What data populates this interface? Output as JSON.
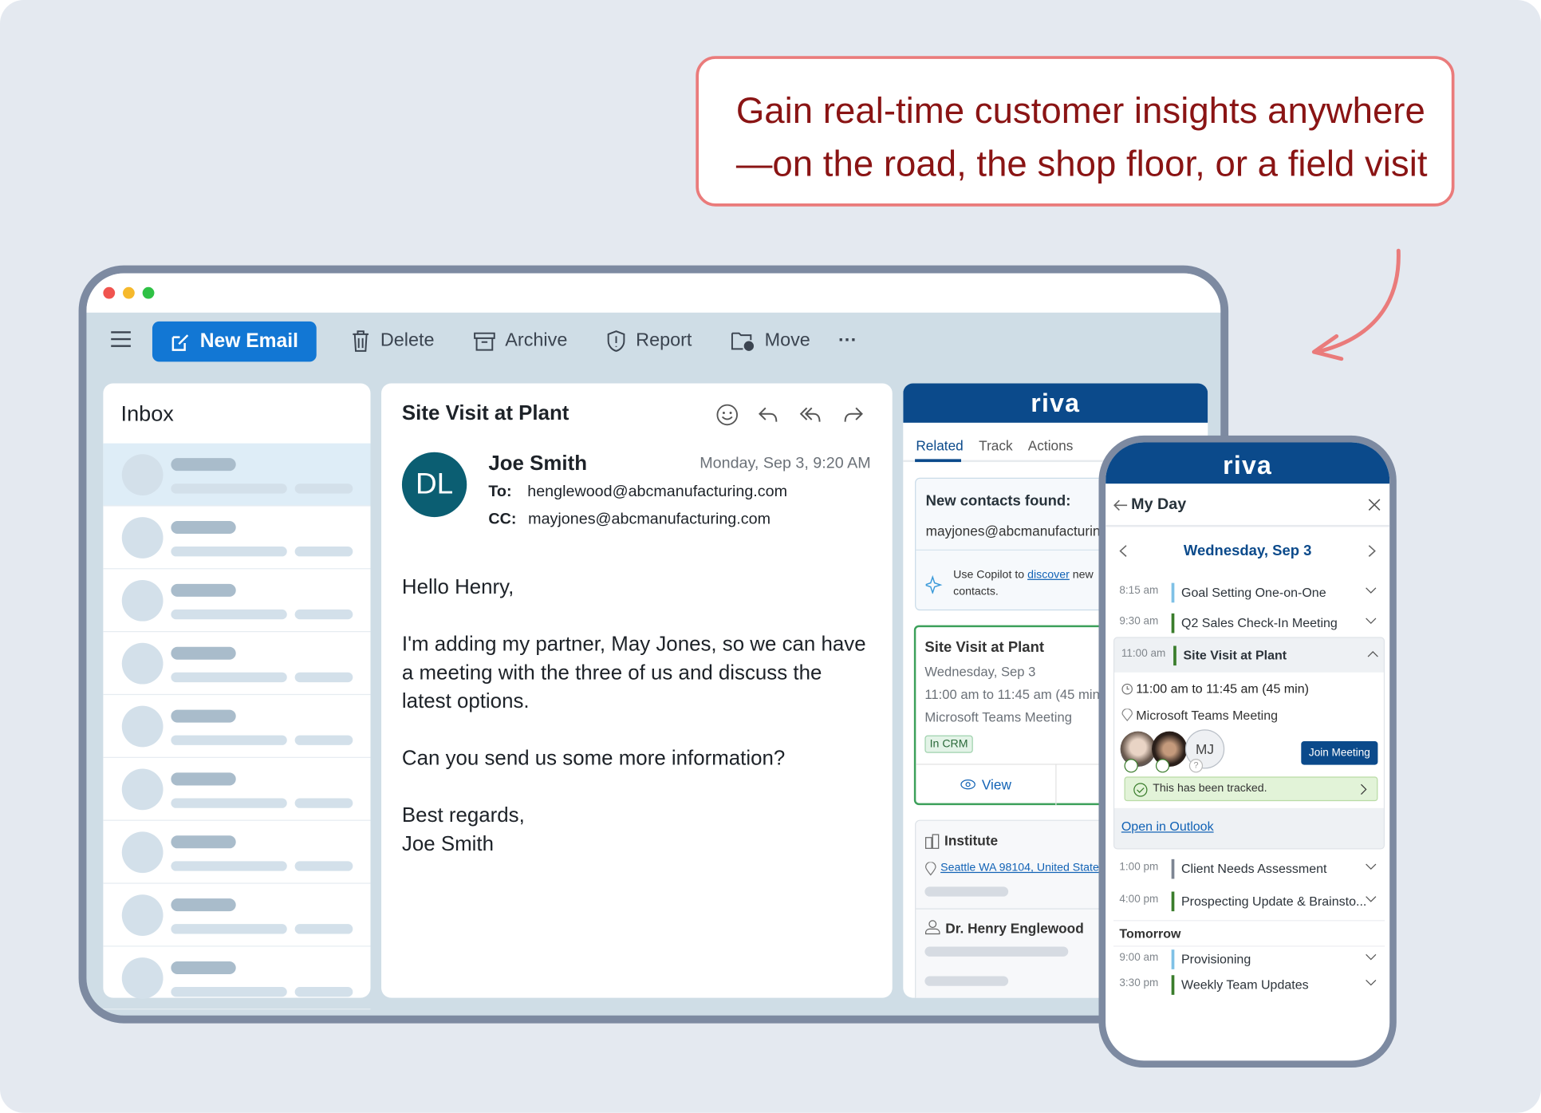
{
  "callout": {
    "line1": "Gain real-time customer insights anywhere",
    "line2": "—on the road, the shop floor, or a field visit",
    "border_color": "#ea7b7b",
    "text_color": "#8a1414"
  },
  "toolbar": {
    "new_email": "New Email",
    "delete": "Delete",
    "archive": "Archive",
    "report": "Report",
    "move": "Move",
    "more": "···"
  },
  "inbox": {
    "title": "Inbox",
    "row_count": 9
  },
  "email": {
    "subject": "Site Visit at Plant",
    "sender": "Joe Smith",
    "avatar_initials": "DL",
    "date": "Monday, Sep 3, 9:20 AM",
    "to_label": "To:",
    "to": "henglewood@abcmanufacturing.com",
    "cc_label": "CC:",
    "cc": "mayjones@abcmanufacturing.com",
    "body": [
      "Hello Henry,",
      "I'm adding my partner, May Jones, so we can have a meeting with the three of us and discuss the latest options.",
      "Can you send us some more information?",
      "Best regards,",
      "Joe Smith"
    ]
  },
  "riva_panel": {
    "logo": "riva",
    "tabs": [
      "Related",
      "Track",
      "Actions"
    ],
    "active_tab": "Related",
    "contacts": {
      "title": "New contacts found:",
      "email": "mayjones@abcmanufacturing.com",
      "copilot_pre": "Use Copilot to ",
      "copilot_link": "discover",
      "copilot_post": " new contacts."
    },
    "meeting": {
      "title": "Site Visit at Plant",
      "date": "Wednesday, Sep 3",
      "time": "11:00 am to 11:45 am (45 min)",
      "location": "Microsoft Teams Meeting",
      "badge": "In CRM",
      "view": "View"
    },
    "institute": {
      "name": "Institute",
      "address": "Seattle WA 98104, United States"
    },
    "person": {
      "name": "Dr. Henry Englewood"
    }
  },
  "phone": {
    "logo": "riva",
    "title": "My Day",
    "date": "Wednesday, Sep 3",
    "events": [
      {
        "time": "8:15 am",
        "name": "Goal Setting One-on-One",
        "color": "#7fc1e6"
      },
      {
        "time": "9:30 am",
        "name": "Q2 Sales Check-In Meeting",
        "color": "#3a7d2c"
      }
    ],
    "expanded": {
      "time": "11:00 am",
      "name": "Site Visit at Plant",
      "color": "#3a7d2c",
      "range": "11:00 am to 11:45 am (45 min)",
      "location": "Microsoft Teams Meeting",
      "attendee_initials": "MJ",
      "join": "Join Meeting",
      "tracked": "This has been tracked.",
      "open": "Open in Outlook"
    },
    "later": [
      {
        "time": "1:00 pm",
        "name": "Client Needs Assessment",
        "color": "#7d8593"
      },
      {
        "time": "4:00 pm",
        "name": "Prospecting Update & Brainsto...",
        "color": "#3a7d2c"
      }
    ],
    "tomorrow_label": "Tomorrow",
    "tomorrow": [
      {
        "time": "9:00 am",
        "name": "Provisioning",
        "color": "#7fc1e6"
      },
      {
        "time": "3:30 pm",
        "name": "Weekly Team Updates",
        "color": "#3a7d2c"
      }
    ]
  }
}
